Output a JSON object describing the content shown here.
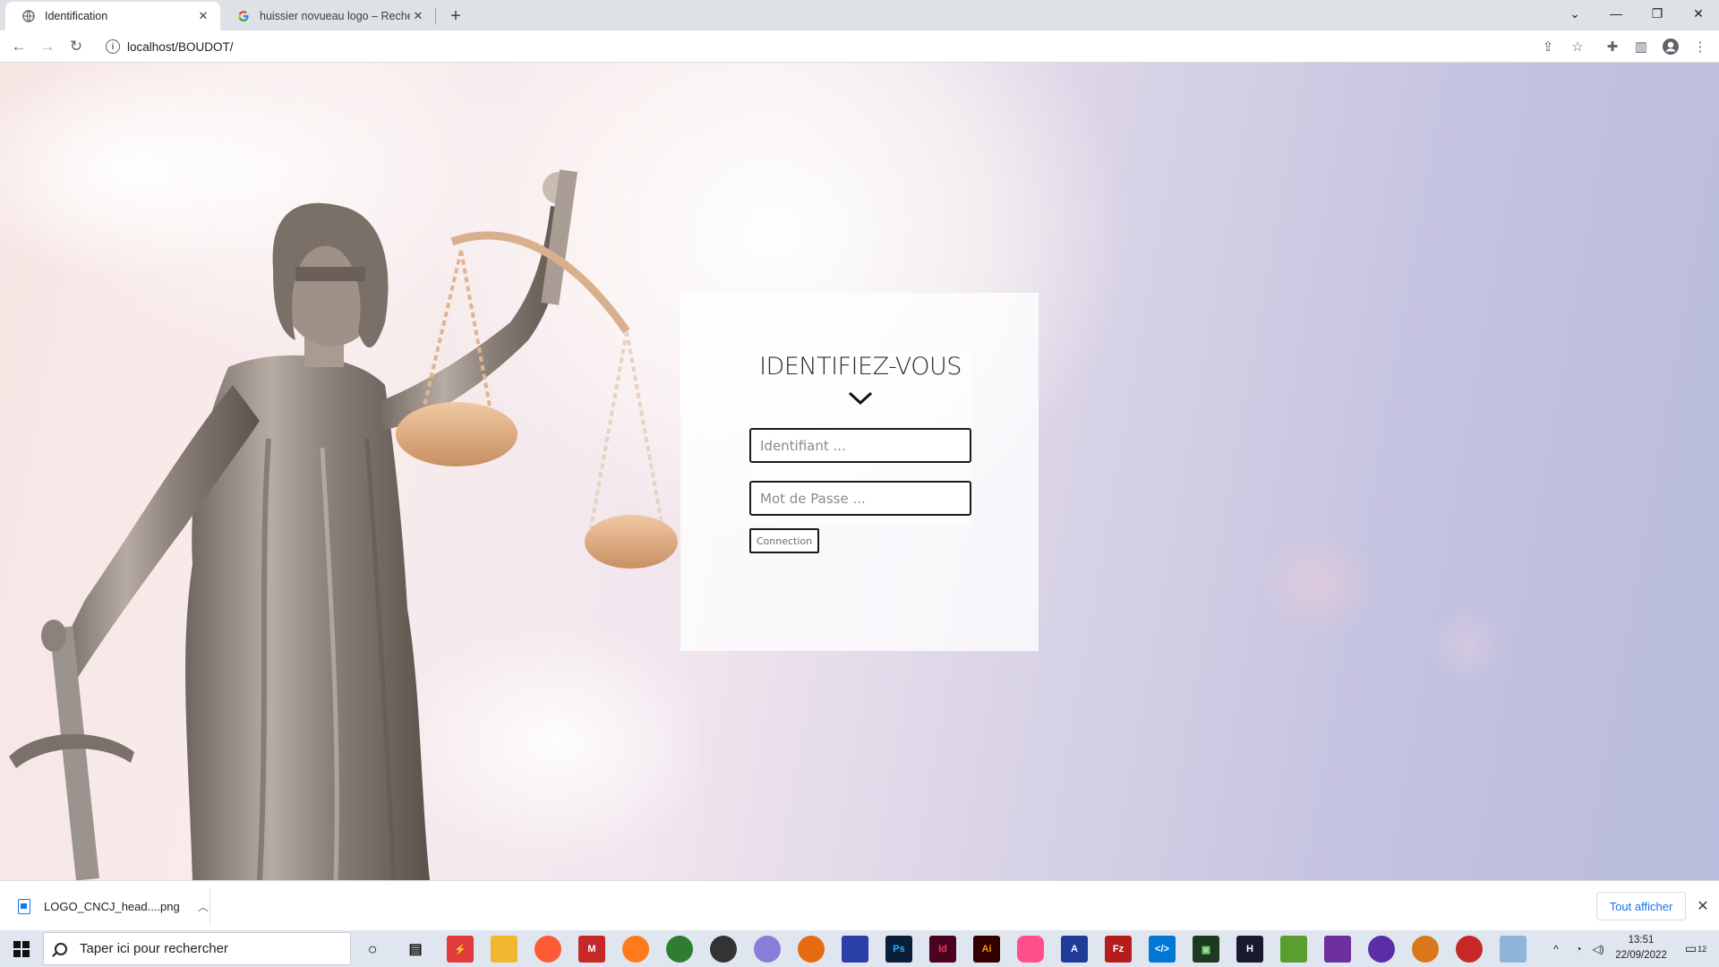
{
  "browser": {
    "tabs": [
      {
        "title": "Identification",
        "active": true
      },
      {
        "title": "huissier novueau logo – Recherche",
        "active": false
      }
    ],
    "address": "localhost/BOUDOT/"
  },
  "login": {
    "title": "IDENTIFIEZ-VOUS",
    "username_placeholder": "Identifiant ...",
    "password_placeholder": "Mot de Passe ...",
    "submit_label": "Connection"
  },
  "downloads": {
    "file": "LOGO_CNCJ_head....png",
    "show_all": "Tout afficher"
  },
  "taskbar": {
    "search_placeholder": "Taper ici pour rechercher",
    "time": "13:51",
    "date": "22/09/2022",
    "notification_count": "12"
  },
  "colors": {
    "chrome_tabstrip": "#dee1e6",
    "link_blue": "#1a73e8",
    "taskbar": "#dfe6ef"
  }
}
